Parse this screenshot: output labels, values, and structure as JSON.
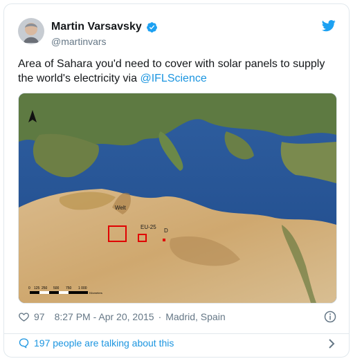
{
  "user": {
    "name": "Martin Varsavsky",
    "handle": "@martinvars"
  },
  "tweet": {
    "text": "Area of Sahara you'd need to cover with solar panels to supply the world's electricity via ",
    "mention": "@IFLScience"
  },
  "map": {
    "labels": {
      "welt": "Welt",
      "eu25": "EU-25",
      "d": "D"
    },
    "scale": {
      "ticks": [
        "0",
        "125",
        "250",
        "500",
        "750",
        "1 000"
      ],
      "unit": "Kilometers"
    }
  },
  "meta": {
    "likes": "97",
    "time": "8:27 PM - Apr 20, 2015",
    "separator": "·",
    "location": "Madrid, Spain"
  },
  "footer": {
    "talking": "197 people are talking about this"
  },
  "colors": {
    "link": "#1b95e0",
    "muted": "#657786",
    "verified": "#1da1f2"
  },
  "icons": {
    "verified": "verified-badge-icon",
    "bird": "twitter-bird-icon",
    "like": "heart-icon",
    "info": "info-icon",
    "reply": "speech-bubble-icon",
    "more": "chevron-right-icon"
  }
}
